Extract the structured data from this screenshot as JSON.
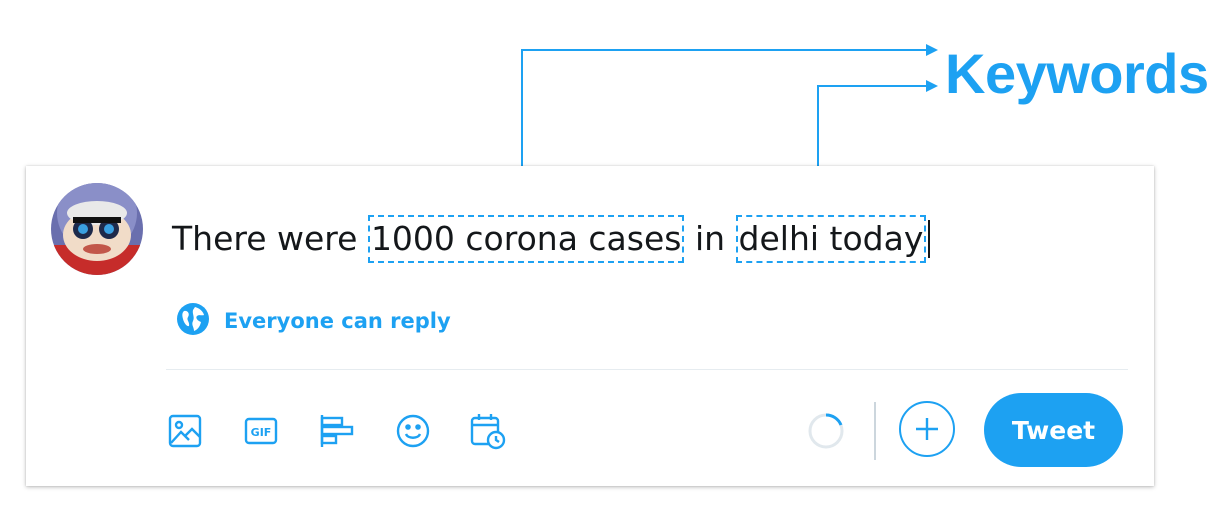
{
  "annotation": {
    "label": "Keywords"
  },
  "composer": {
    "text_segments": [
      {
        "text": "There were ",
        "keyword": false
      },
      {
        "text": "1000 corona cases",
        "keyword": true
      },
      {
        "text": " in ",
        "keyword": false
      },
      {
        "text": "delhi today",
        "keyword": true
      }
    ],
    "reply_setting": "Everyone can reply",
    "toolbar_icons": [
      "image-icon",
      "gif-icon",
      "poll-icon",
      "emoji-icon",
      "schedule-icon"
    ],
    "gif_label": "GIF",
    "tweet_button_label": "Tweet"
  },
  "colors": {
    "accent": "#1da1f2",
    "text": "#14171a",
    "divider": "#e6ecf0"
  }
}
